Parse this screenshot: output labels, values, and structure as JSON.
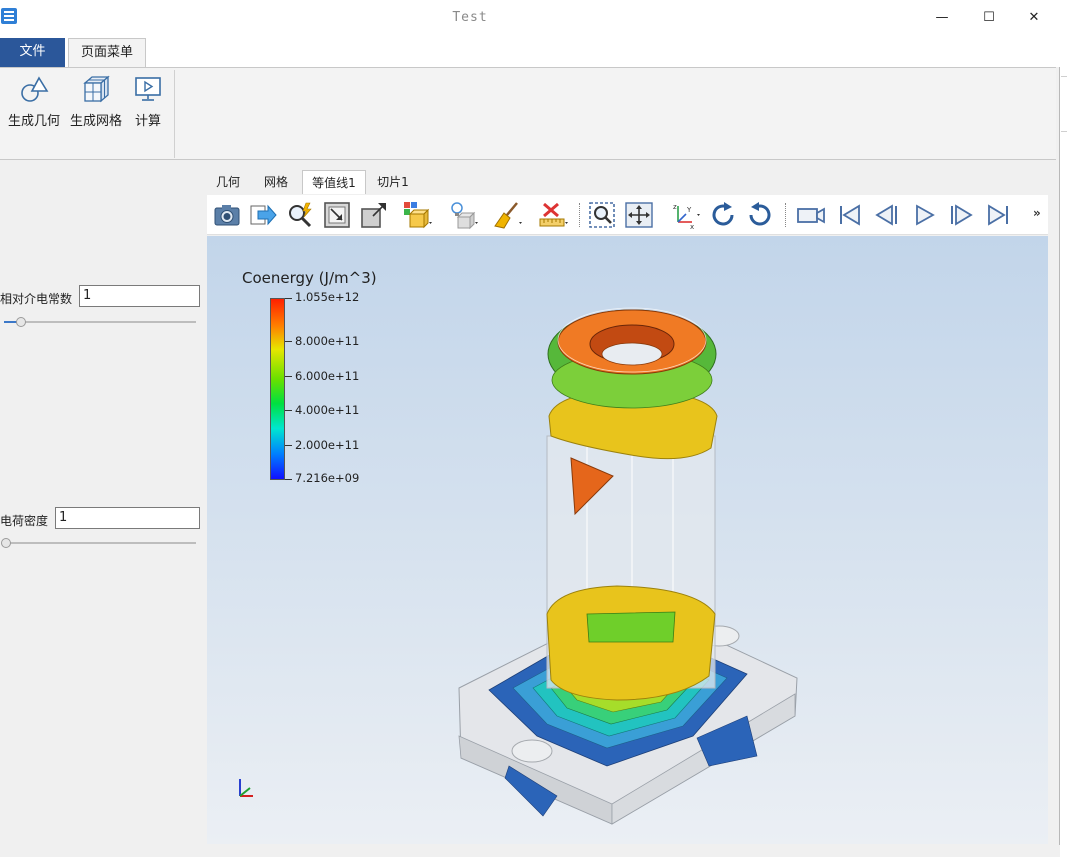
{
  "window": {
    "title": "Test",
    "minimize": "—",
    "maximize": "☐",
    "close": "✕"
  },
  "ribbon": {
    "tabs": [
      {
        "label": "文件"
      },
      {
        "label": "页面菜单"
      }
    ],
    "buttons": [
      {
        "label": "生成几何"
      },
      {
        "label": "生成网格"
      },
      {
        "label": "计算"
      }
    ]
  },
  "params": [
    {
      "label": "相对介电常数",
      "value": "1",
      "slider": 0.1
    },
    {
      "label": "电荷密度",
      "value": "1",
      "slider": 0.0
    }
  ],
  "view_tabs": [
    {
      "label": "几何"
    },
    {
      "label": "网格"
    },
    {
      "label": "等值线1"
    },
    {
      "label": "切片1"
    }
  ],
  "toolbar": {
    "icons": [
      "camera-icon",
      "export-icon",
      "zoom-auto-icon",
      "fit-view-icon",
      "reset-view-icon",
      "representation-icon",
      "light-icon",
      "clear-icon",
      "ruler-icon",
      "zoom-box-icon",
      "pan-icon",
      "axis-orient-icon",
      "rotate-cw-icon",
      "rotate-ccw-icon",
      "video-camera-icon",
      "first-frame-icon",
      "prev-frame-icon",
      "play-icon",
      "next-frame-icon",
      "last-frame-icon"
    ],
    "more": "»"
  },
  "legend": {
    "title": "Coenergy (J/m^3)",
    "labels": [
      "1.055e+12",
      "8.000e+11",
      "6.000e+11",
      "4.000e+11",
      "2.000e+11",
      "7.216e+09"
    ],
    "colors": [
      "#ff2000",
      "#ff8000",
      "#e6e600",
      "#00e040",
      "#00e6d0",
      "#1010ff"
    ]
  }
}
